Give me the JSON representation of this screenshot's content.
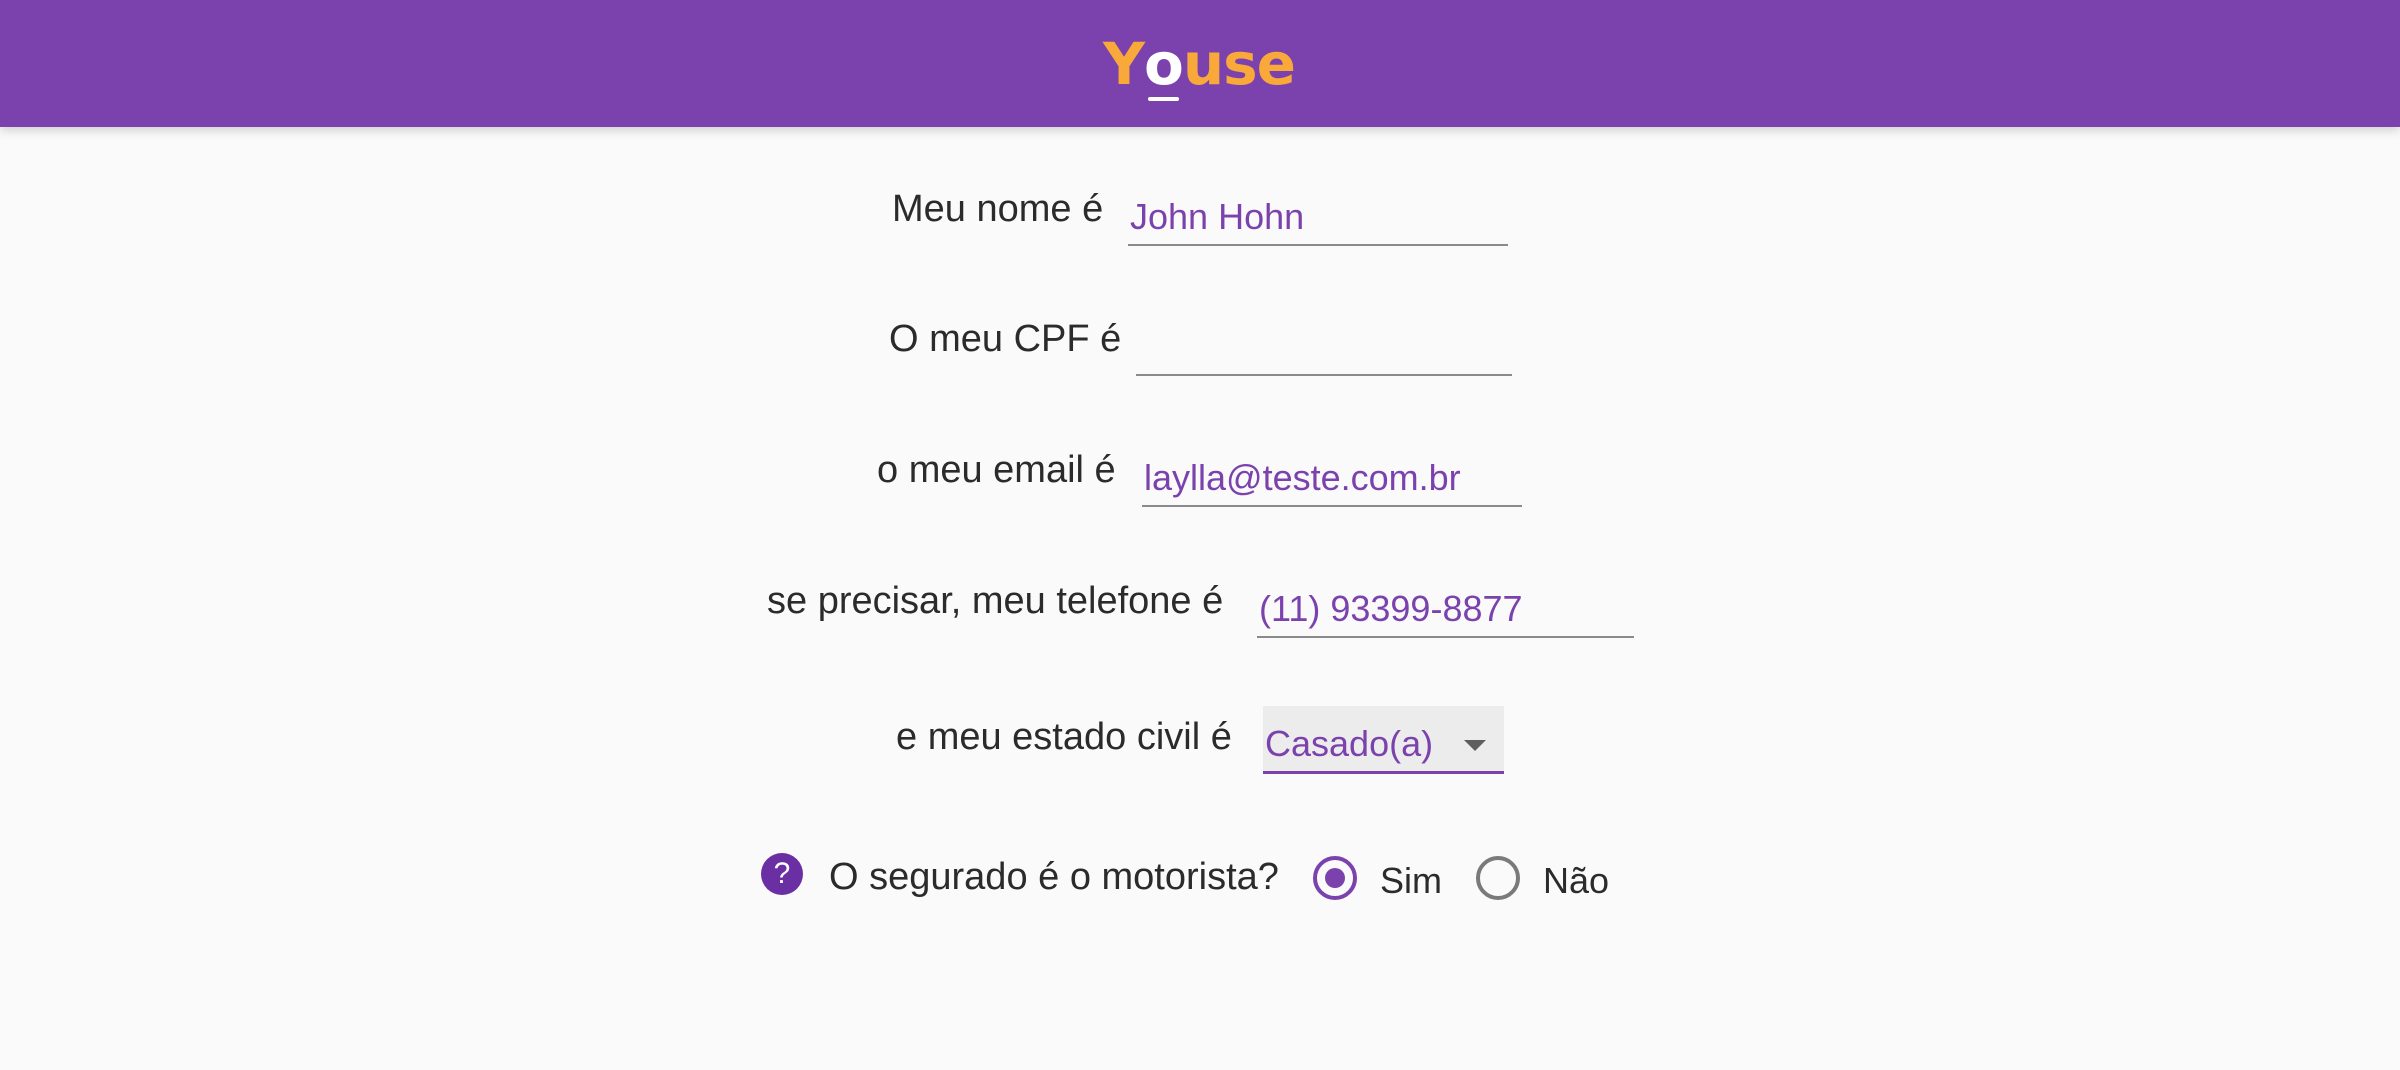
{
  "header": {
    "logo_y": "Y",
    "logo_o": "o",
    "logo_rest": "use",
    "colors": {
      "bar": "#7b42ae",
      "logo": "#f9a83a"
    }
  },
  "form": {
    "name": {
      "label": "Meu nome é",
      "value": "John Hohn"
    },
    "cpf": {
      "label": "O meu CPF é",
      "value": ""
    },
    "email": {
      "label": "o meu email é",
      "value": "laylla@teste.com.br"
    },
    "phone": {
      "label": "se precisar, meu telefone é",
      "value": "(11) 93399-8877"
    },
    "civil_status": {
      "label": "e meu estado civil é",
      "value": "Casado(a)"
    },
    "driver": {
      "help_icon": "?",
      "question": "O segurado é o motorista?",
      "options": [
        {
          "label": "Sim",
          "checked": true
        },
        {
          "label": "Não",
          "checked": false
        }
      ]
    }
  }
}
